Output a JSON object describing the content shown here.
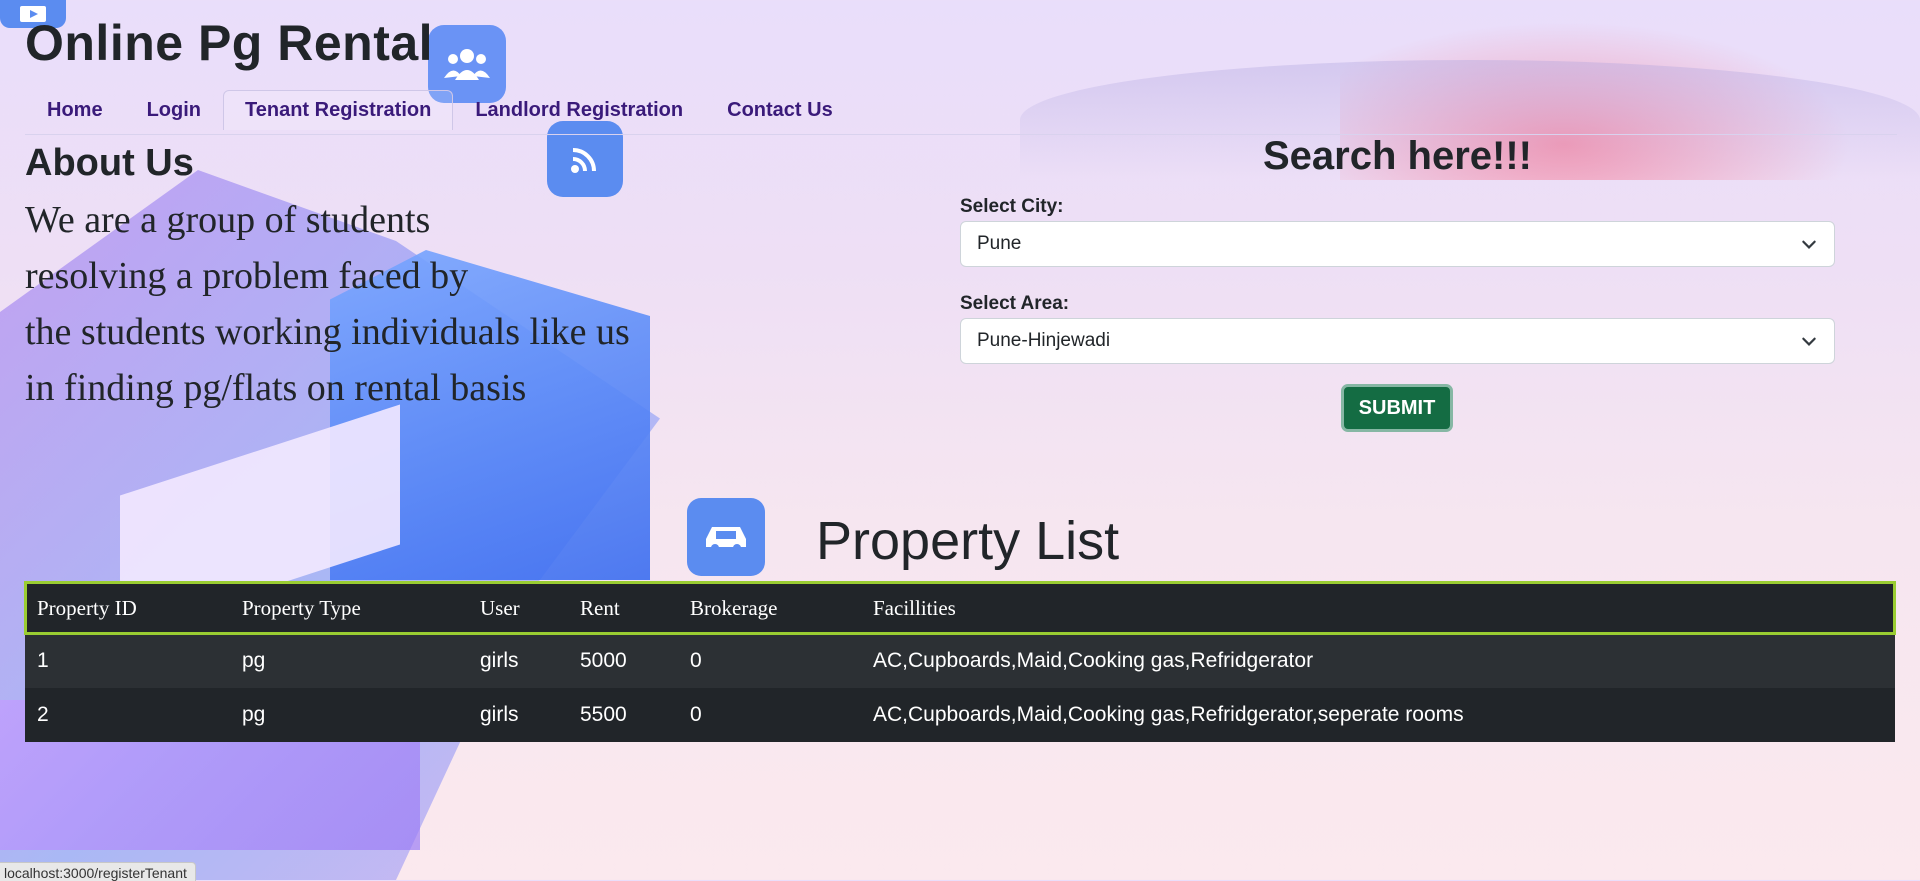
{
  "site": {
    "title": "Online Pg Rental"
  },
  "nav": {
    "items": [
      {
        "label": "Home"
      },
      {
        "label": "Login"
      },
      {
        "label": "Tenant Registration"
      },
      {
        "label": "Landlord Registration"
      },
      {
        "label": "Contact Us"
      }
    ],
    "active": "Tenant Registration"
  },
  "about": {
    "heading": "About Us",
    "lines": [
      "We are a group of students",
      "resolving a problem faced by",
      "the students working individuals like us",
      "in finding pg/flats on rental basis"
    ]
  },
  "search": {
    "heading": "Search here!!!",
    "city_label": "Select City:",
    "city_value": "Pune",
    "area_label": "Select Area:",
    "area_value": "Pune-Hinjewadi",
    "submit_label": "SUBMIT"
  },
  "property_list": {
    "heading": "Property List",
    "columns": [
      "Property ID",
      "Property Type",
      "User",
      "Rent",
      "Brokerage",
      "Facillities"
    ],
    "rows": [
      [
        "1",
        "pg",
        "girls",
        "5000",
        "0",
        "AC,Cupboards,Maid,Cooking gas,Refridgerator"
      ],
      [
        "2",
        "pg",
        "girls",
        "5500",
        "0",
        "AC,Cupboards,Maid,Cooking gas,Refridgerator,seperate rooms"
      ]
    ]
  },
  "status_bar": {
    "url": "localhost:3000/registerTenant"
  },
  "colors": {
    "nav_text": "#3a1a7a",
    "submit_bg": "#146c43",
    "table_bg": "#212529",
    "header_outline": "#9acd32"
  },
  "icons": [
    "video-icon",
    "users-icon",
    "wifi-icon",
    "car-icon",
    "chevron-down-icon"
  ]
}
